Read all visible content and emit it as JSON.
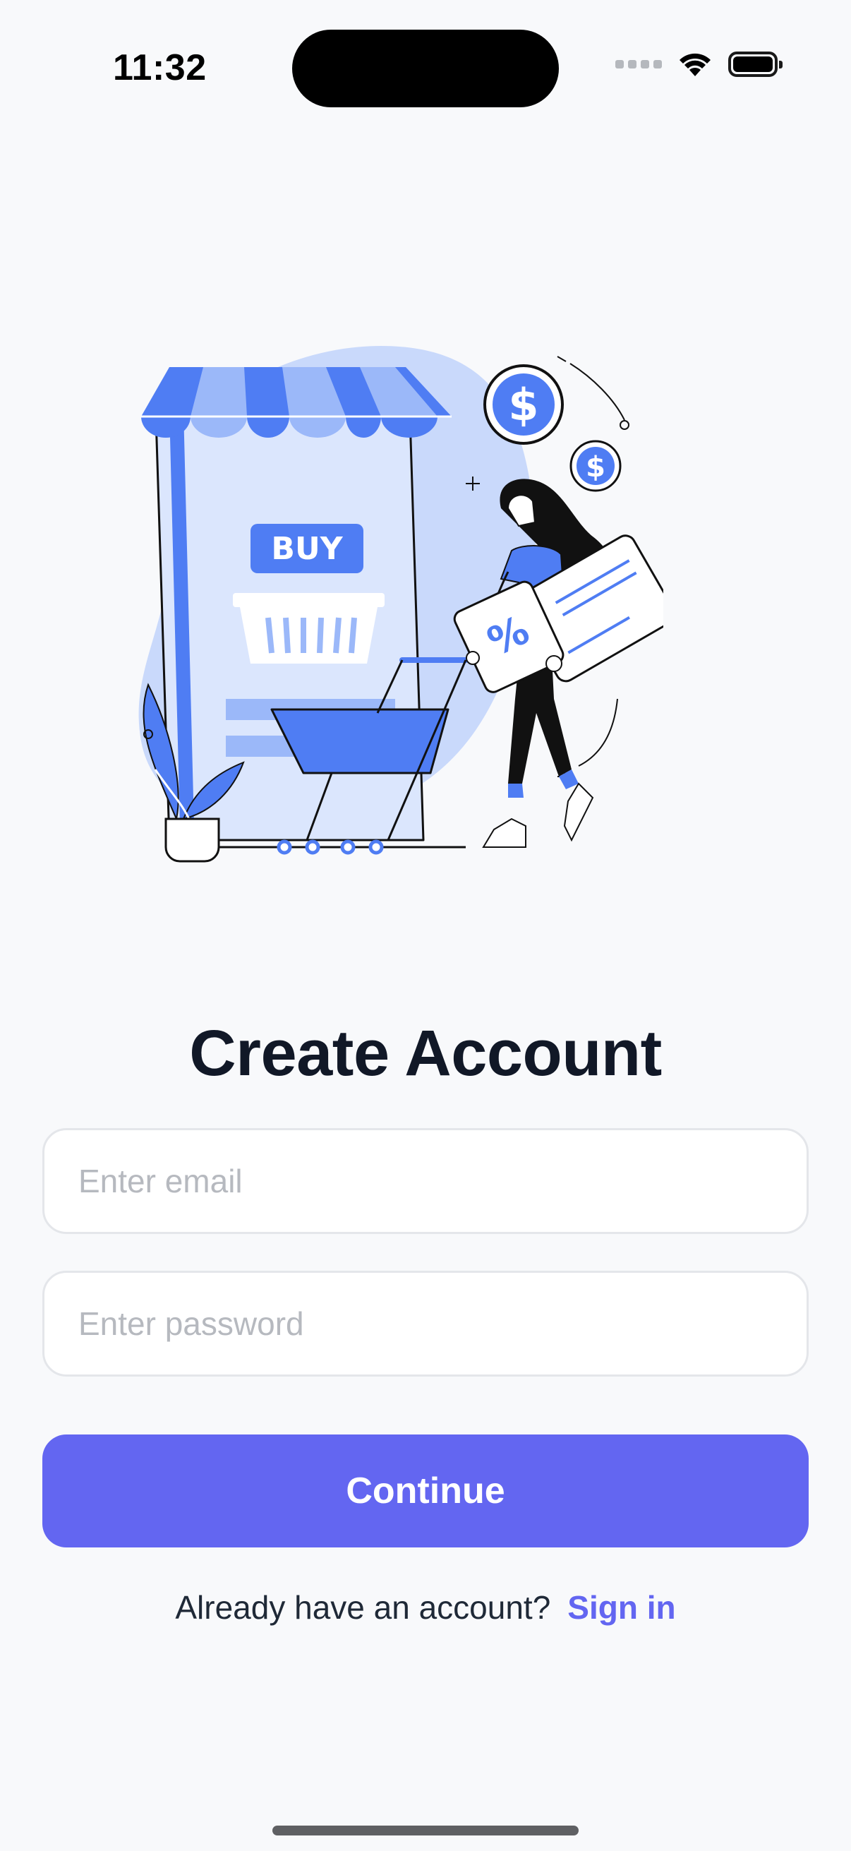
{
  "status_bar": {
    "time": "11:32"
  },
  "illustration": {
    "buy_label": "BUY",
    "percent_label": "%",
    "dollar_label": "$"
  },
  "form": {
    "title": "Create Account",
    "email_placeholder": "Enter email",
    "password_placeholder": "Enter password",
    "continue_label": "Continue"
  },
  "footer": {
    "prompt": "Already have an account?",
    "signin_label": "Sign in"
  },
  "colors": {
    "accent": "#6366f1",
    "illustration_blue": "#4f7df3",
    "illustration_light": "#c9d9fb",
    "title": "#111827"
  }
}
